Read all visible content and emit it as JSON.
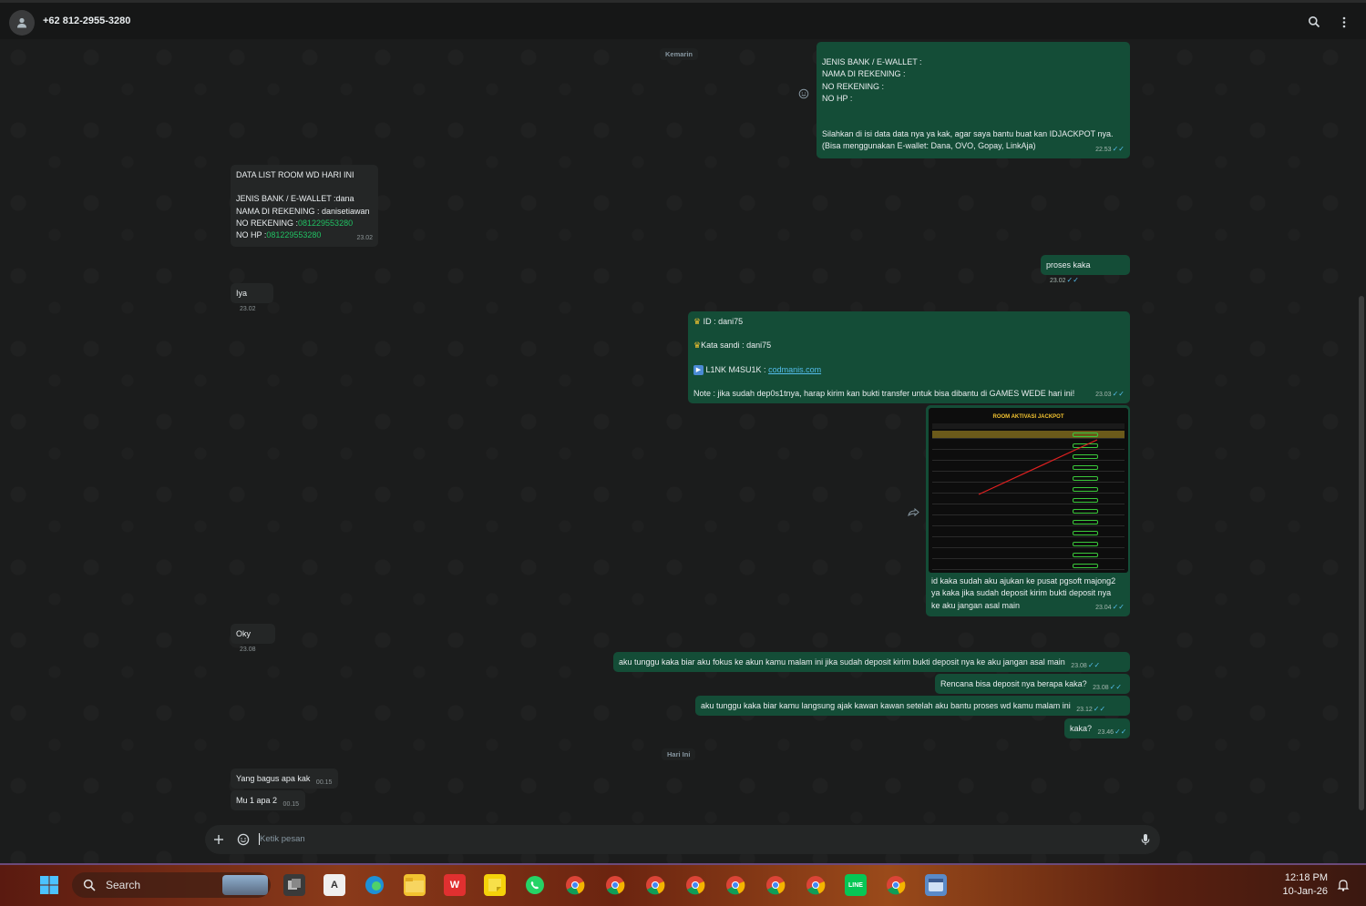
{
  "header": {
    "contact": "+62 812-2955-3280"
  },
  "days": {
    "yesterday": "Kemarin",
    "today": "Hari Ini"
  },
  "messages": {
    "m1": {
      "lines": [
        "JENIS BANK / E-WALLET :",
        "NAMA DI REKENING :",
        "NO REKENING :",
        "NO HP :",
        "",
        "",
        "Silahkan di isi data data nya ya kak, agar saya bantu buat kan IDJACKPOT nya.",
        "(Bisa menggunakan E-wallet: Dana, OVO, Gopay, LinkAja)"
      ],
      "time": "22.53"
    },
    "m2": {
      "title": "DATA LIST ROOM WD HARI INI",
      "bank": "JENIS BANK / E-WALLET :dana",
      "name": "NAMA DI REKENING : danisetiawan",
      "rek_label": "NO REKENING :",
      "rek_value": "081229553280",
      "hp_label": "NO HP :",
      "hp_value": "081229553280",
      "time": "23.02"
    },
    "m3": {
      "text": "proses kaka",
      "time": "23.02"
    },
    "m4": {
      "text": "Iya",
      "time": "23.02"
    },
    "m5": {
      "id": "ID :  dani75",
      "pass": "Kata sandi : dani75",
      "link_label": "L1NK M4SU1K :",
      "link": "codmanis.com",
      "note": "Note : jika sudah dep0s1tnya, harap kirim kan bukti transfer untuk bisa dibantu di GAMES WEDE hari ini!",
      "time": "23.03"
    },
    "m6": {
      "image_title": "ROOM AKTIVASI JACKPOT",
      "caption": [
        "id kaka sudah aku ajukan ke pusat pgsoft majong2",
        "ya kaka jika sudah deposit kirim bukti deposit nya",
        "ke aku jangan asal main"
      ],
      "time": "23.04"
    },
    "m7": {
      "text": "Oky",
      "time": "23.08"
    },
    "m8": {
      "text": "aku tunggu kaka biar aku fokus ke akun kamu malam ini jika sudah deposit kirim bukti deposit nya ke aku jangan asal main",
      "time": "23.08"
    },
    "m9": {
      "text": "Rencana bisa deposit nya berapa kaka?",
      "time": "23.08"
    },
    "m10": {
      "text": "aku tunggu kaka biar kamu langsung ajak kawan kawan setelah aku bantu proses wd kamu malam ini",
      "time": "23.12"
    },
    "m11": {
      "text": "kaka?",
      "time": "23.46"
    },
    "m12": {
      "text": "Yang bagus apa kak",
      "time": "00.15"
    },
    "m13": {
      "text": "Mu 1 apa 2",
      "time": "00.15"
    }
  },
  "composer": {
    "placeholder": "Ketik pesan"
  },
  "taskbar": {
    "search": "Search",
    "time": "12:18 PM",
    "date": "10-Jan-26"
  }
}
